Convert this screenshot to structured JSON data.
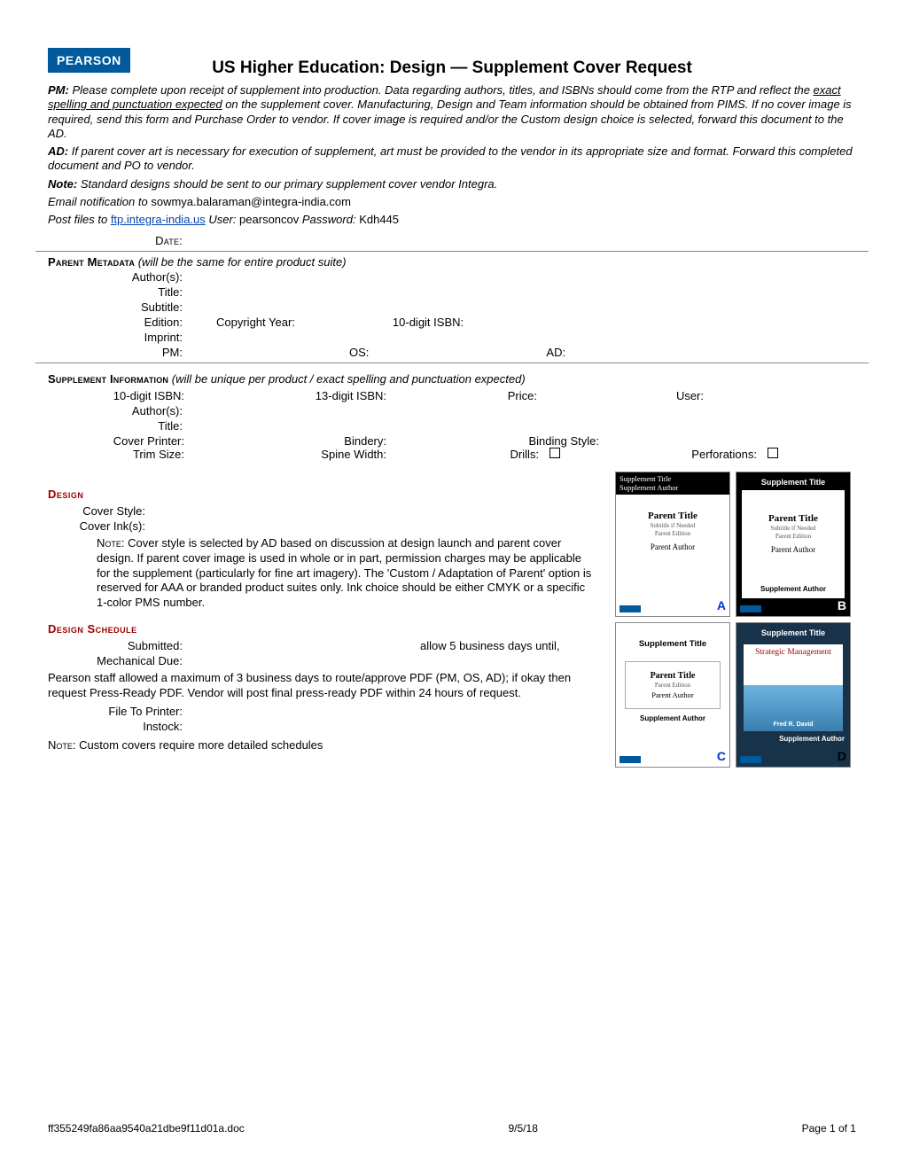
{
  "brand": "PEARSON",
  "title": "US Higher Education: Design — Supplement Cover Request",
  "intro": {
    "pm_lead": "PM:",
    "pm_text1": " Please complete upon receipt of supplement into production. Data regarding authors, titles, and ISBNs should come from the RTP and reflect the ",
    "pm_underline": "exact spelling and punctuation expected",
    "pm_text2": " on the supplement cover. Manufacturing, Design and Team information should be obtained from PIMS. If no cover image is required, send this form and Purchase Order to vendor. If cover image is required and/or the Custom design choice is selected, forward this document to the AD.",
    "ad_lead": "AD:",
    "ad_text": " If parent cover art is necessary for execution of supplement, art must be provided to the vendor in its appropriate size and format. Forward this completed document and PO to vendor.",
    "note_lead": "Note:",
    "note_text": " Standard designs should be sent to our primary supplement cover vendor Integra.",
    "email_line_pre": "Email notification to ",
    "email": "sowmya.balaraman@integra-india.com",
    "post_pre": "Post files to ",
    "ftp": "ftp.integra-india.us",
    "post_user_lbl": "  User:",
    "post_user": " pearsoncov ",
    "post_pwd_lbl": "Password:",
    "post_pwd": " Kdh445"
  },
  "labels": {
    "date": "Date:",
    "parent_meta": "Parent Metadata",
    "parent_meta_note": " (will be the same for entire product suite)",
    "authors": "Author(s):",
    "title": "Title:",
    "subtitle": "Subtitle:",
    "edition": "Edition:",
    "copyright_year": "Copyright Year:",
    "isbn10": "10-digit ISBN:",
    "imprint": "Imprint:",
    "pm": "PM:",
    "os": "OS:",
    "ad": "AD:",
    "supp_info": "Supplement Information",
    "supp_info_note": "   (will be unique per product / exact spelling and punctuation expected)",
    "isbn13": "13-digit ISBN:",
    "price": "Price:",
    "user": "User:",
    "cover_printer": "Cover Printer:",
    "bindery": "Bindery:",
    "binding_style": "Binding Style:",
    "trim_size": "Trim Size:",
    "spine_width": "Spine Width:",
    "drills": "Drills:",
    "perforations": "Perforations:",
    "design": "Design",
    "cover_style": "Cover Style:",
    "cover_ink": "Cover Ink(s):",
    "design_note_lead": "Note",
    "design_note": ": Cover style is selected by AD based on discussion at design launch and parent cover design. If parent cover image is used in whole or in part, permission charges may be applicable for the supplement (particularly for fine art imagery). The 'Custom / Adaptation of Parent' option is reserved for AAA or branded product suites only. Ink choice should be either CMYK or a specific 1-color PMS number.",
    "design_schedule": "Design Schedule",
    "submitted": "Submitted:",
    "allow5": "allow 5 business days until,",
    "mech_due": "Mechanical Due:",
    "sched_para": "Pearson staff allowed a maximum of 3 business days to route/approve PDF (PM, OS, AD); if okay then request Press-Ready PDF. Vendor will post final press-ready PDF within 24 hours of request.",
    "file_to_printer": "File To Printer:",
    "instock": "Instock:",
    "custom_note_lead": "Note",
    "custom_note": ": Custom covers require more detailed schedules"
  },
  "thumbs": {
    "supp_title": "Supplement Title",
    "supp_author": "Supplement Author",
    "parent_title": "Parent Title",
    "subtitle_if": "Subtitle if Needed",
    "edition": "Parent Edition",
    "parent_author": "Parent Author",
    "strategic": "Strategic Management",
    "author_d": "Fred R. David",
    "a": "A",
    "b": "B",
    "c": "C",
    "d": "D"
  },
  "footer": {
    "file": "ff355249fa86aa9540a21dbe9f11d01a.doc",
    "date": "9/5/18",
    "page": "Page 1 of 1"
  }
}
